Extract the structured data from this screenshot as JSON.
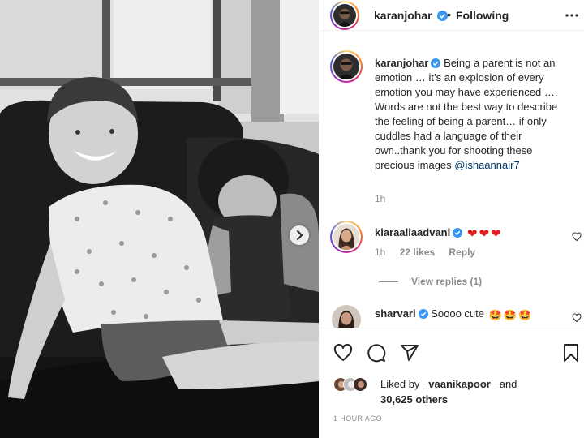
{
  "post": {
    "author": "karanjohar",
    "separator": "•",
    "follow_status": "Following",
    "time_ago": "1 HOUR AGO"
  },
  "caption": {
    "username": "karanjohar",
    "text": "Being a parent is not an emotion … it’s an explosion of every emotion you may have experienced …. Words are not the best way to describe the feeling of being a parent… if only cuddles had a language of their own..thank you for shooting these precious images",
    "mention": "@ishaannair7",
    "time": "1h"
  },
  "comments": [
    {
      "username": "kiaraaliaadvani",
      "text": "",
      "emoji": [
        "❤",
        "❤",
        "❤"
      ],
      "time": "1h",
      "likes": "22 likes",
      "reply_label": "Reply",
      "view_replies": "View replies (1)"
    },
    {
      "username": "sharvari",
      "text": "Soooo cute",
      "emoji": [
        "🤩",
        "🤩",
        "🤩"
      ]
    }
  ],
  "likes": {
    "prefix": "Liked by",
    "user": "_vaanikapoor_",
    "conjunction": "and",
    "count": "30,625 others"
  },
  "icons": {
    "more": "more-horizontal-icon",
    "like": "heart-icon",
    "comment": "comment-icon",
    "share": "share-icon",
    "save": "bookmark-icon",
    "next": "chevron-right-icon",
    "verified": "verified-badge-icon"
  },
  "colors": {
    "verified_blue": "#3897f0",
    "heart_red": "#ed4956",
    "text": "#262626",
    "muted": "#8e8e8e",
    "link": "#00376b"
  }
}
